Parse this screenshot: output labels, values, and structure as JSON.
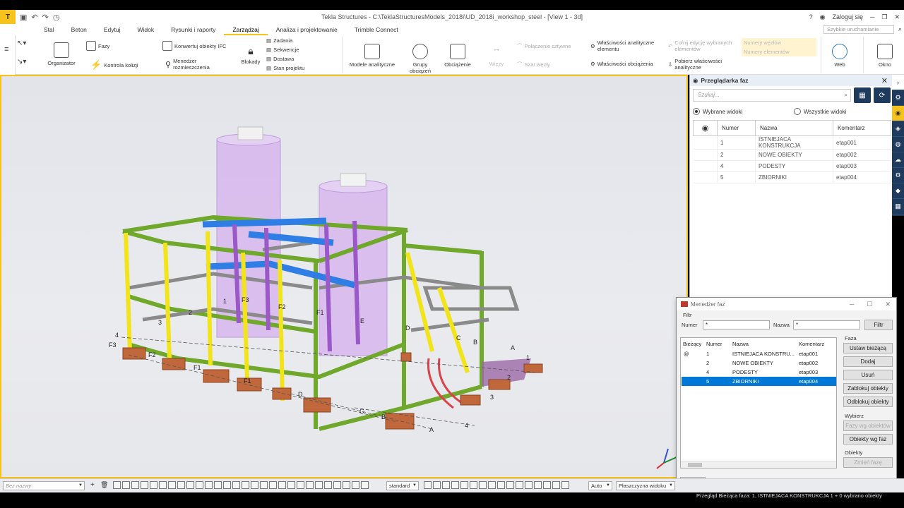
{
  "app": {
    "title": "Tekla Structures - C:\\TeklaStructuresModels_2018i\\UD_2018i_workshop_steel - [View 1 - 3d]",
    "logo_text": "T",
    "login": "Zaloguj się",
    "help": "?",
    "quick_launch": "Szybkie uruchamianie"
  },
  "tabs": [
    "Stal",
    "Beton",
    "Edytuj",
    "Widok",
    "Rysunki i raporty",
    "Zarządzaj",
    "Analiza i projektowanie",
    "Trimble Connect"
  ],
  "active_tab": "Zarządzaj",
  "ribbon": {
    "organizator": "Organizator",
    "fazy": "Fazy",
    "kontrola_kolizji": "Kontrola kolizji",
    "konwertuj_ifc": "Konwertuj obiekty IFC",
    "menedzer_rozmieszczenia": "Menedżer rozmieszczenia",
    "blokady": "Blokady",
    "zadania": "Zadania",
    "sekwencje": "Sekwencje",
    "dostawa": "Dostawa",
    "stan_projektu": "Stan projektu",
    "modele_analityczne": "Modele analityczne",
    "grupy_obciazen": "Grupy obciążeń",
    "obciazenie": "Obciążenie",
    "wiezy": "Więzy",
    "polaczenie_sztywne": "Połączenie sztywne",
    "szar_wezly": "Szar węzły",
    "wlasciwosci_analityczne": "Właściwości analityczne elementu",
    "wlasciwosci_obciazenia": "Właściwości obciążenia",
    "cofnij_edycje": "Cofnij edycję wybranych elementów",
    "pobierz_wlasciwosci": "Pobierz właściwości analityczne",
    "numery_wezlow": "Numery węzłów",
    "numery_elementow": "Numery elementów",
    "web": "Web",
    "okno": "Okno"
  },
  "phase_browser": {
    "title": "Przeglądarka faz",
    "search_placeholder": "Szukaj...",
    "radio_selected": "Wybrane widoki",
    "radio_all": "Wszystkie widoki",
    "columns": [
      "Numer",
      "Nazwa",
      "Komentarz"
    ],
    "rows": [
      {
        "num": "1",
        "name": "ISTNIEJACA KONSTRUKCJA",
        "comment": "etap001"
      },
      {
        "num": "2",
        "name": "NOWE OBIEKTY",
        "comment": "etap002"
      },
      {
        "num": "4",
        "name": "PODESTY",
        "comment": "etap003"
      },
      {
        "num": "5",
        "name": "ZBIORNIKI",
        "comment": "etap004"
      }
    ]
  },
  "phase_manager": {
    "title": "Menedżer faz",
    "filter_label": "Filtr",
    "numer_label": "Numer",
    "numer_value": "*",
    "nazwa_label": "Nazwa",
    "nazwa_value": "*",
    "filter_button": "Filtr",
    "columns": [
      "Bieżący",
      "Numer",
      "Nazwa",
      "Komentarz"
    ],
    "rows": [
      {
        "current": "@",
        "num": "1",
        "name": "ISTNIEJACA KONSTRU...",
        "comment": "etap001"
      },
      {
        "current": "",
        "num": "2",
        "name": "NOWE OBIEKTY",
        "comment": "etap002"
      },
      {
        "current": "",
        "num": "4",
        "name": "PODESTY",
        "comment": "etap003"
      },
      {
        "current": "",
        "num": "5",
        "name": "ZBIORNIKI",
        "comment": "etap004"
      }
    ],
    "selected_row": 3,
    "group_faza": "Faza",
    "btn_ustaw": "Ustaw bieżącą",
    "btn_dodaj": "Dodaj",
    "btn_usun": "Usuń",
    "btn_zablokuj": "Zablokuj obiekty",
    "btn_odblokuj": "Odblokuj obiekty",
    "group_wybierz": "Wybierz",
    "btn_fazy_wg": "Fazy wg obiektów",
    "btn_obiekty_wg": "Obiekty wg faz",
    "group_obiekty": "Obiekty",
    "btn_zmien": "Zmień fazę",
    "btn_ok": "OK"
  },
  "statusbar": {
    "name_placeholder": "Bez nazwy",
    "standard": "standard",
    "auto": "Auto",
    "plane": "Płaszczyzna widoku",
    "count_a": "0",
    "count_b": "0",
    "status": "Przegląd  Bieżąca faza: 1, ISTNIEJACA KONSTRUKCJA  1 + 0 wybrano obiekty"
  },
  "grid_labels": [
    "4",
    "F3",
    "F2",
    "F1",
    "F1",
    "F2",
    "F3",
    "F1",
    "D",
    "C",
    "B",
    "A",
    "E",
    "D",
    "C",
    "B",
    "A",
    "1",
    "2",
    "3",
    "4",
    "1",
    "2",
    "3"
  ],
  "colors": {
    "accent": "#f7c21b",
    "panel_dark": "#1e3a5c",
    "selection": "#0078d7"
  }
}
